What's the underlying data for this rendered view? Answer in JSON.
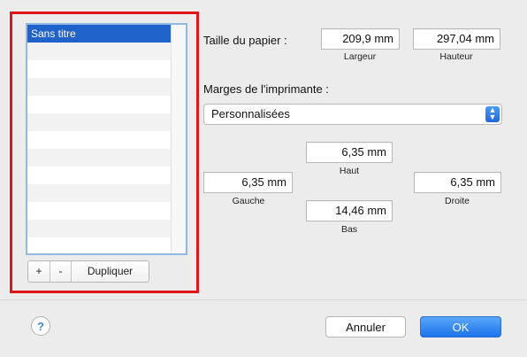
{
  "presets": {
    "items": [
      "Sans titre"
    ],
    "selected_index": 0,
    "add_label": "+",
    "remove_label": "-",
    "duplicate_label": "Dupliquer"
  },
  "paper": {
    "label": "Taille du papier :",
    "width_value": "209,9 mm",
    "width_caption": "Largeur",
    "height_value": "297,04 mm",
    "height_caption": "Hauteur"
  },
  "margins": {
    "label": "Marges de l'imprimante :",
    "selected": "Personnalisées",
    "top_value": "6,35 mm",
    "top_caption": "Haut",
    "left_value": "6,35 mm",
    "left_caption": "Gauche",
    "right_value": "6,35 mm",
    "right_caption": "Droite",
    "bottom_value": "14,46 mm",
    "bottom_caption": "Bas"
  },
  "footer": {
    "help_label": "?",
    "cancel_label": "Annuler",
    "ok_label": "OK"
  },
  "colors": {
    "highlight": "#e0141b",
    "selection": "#1f62c9",
    "accent": "#1d73ea"
  }
}
